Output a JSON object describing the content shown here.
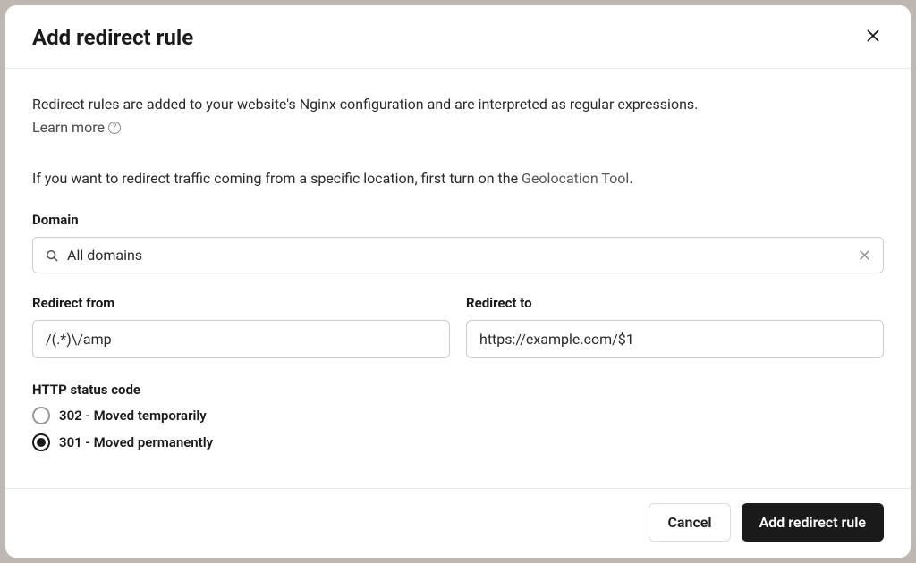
{
  "header": {
    "title": "Add redirect rule"
  },
  "body": {
    "description": "Redirect rules are added to your website's Nginx configuration and are interpreted as regular expressions.",
    "learn_more_label": "Learn more",
    "geo_prefix": "If you want to redirect traffic coming from a specific location, first turn on the ",
    "geo_link": "Geolocation Tool",
    "geo_suffix": "."
  },
  "domain": {
    "label": "Domain",
    "value": "All domains"
  },
  "redirect_from": {
    "label": "Redirect from",
    "value": "/(.*)\\/amp"
  },
  "redirect_to": {
    "label": "Redirect to",
    "value": "https://example.com/$1"
  },
  "status_code": {
    "label": "HTTP status code",
    "options": [
      {
        "label": "302 - Moved temporarily",
        "selected": false
      },
      {
        "label": "301 - Moved permanently",
        "selected": true
      }
    ]
  },
  "footer": {
    "cancel_label": "Cancel",
    "submit_label": "Add redirect rule"
  }
}
